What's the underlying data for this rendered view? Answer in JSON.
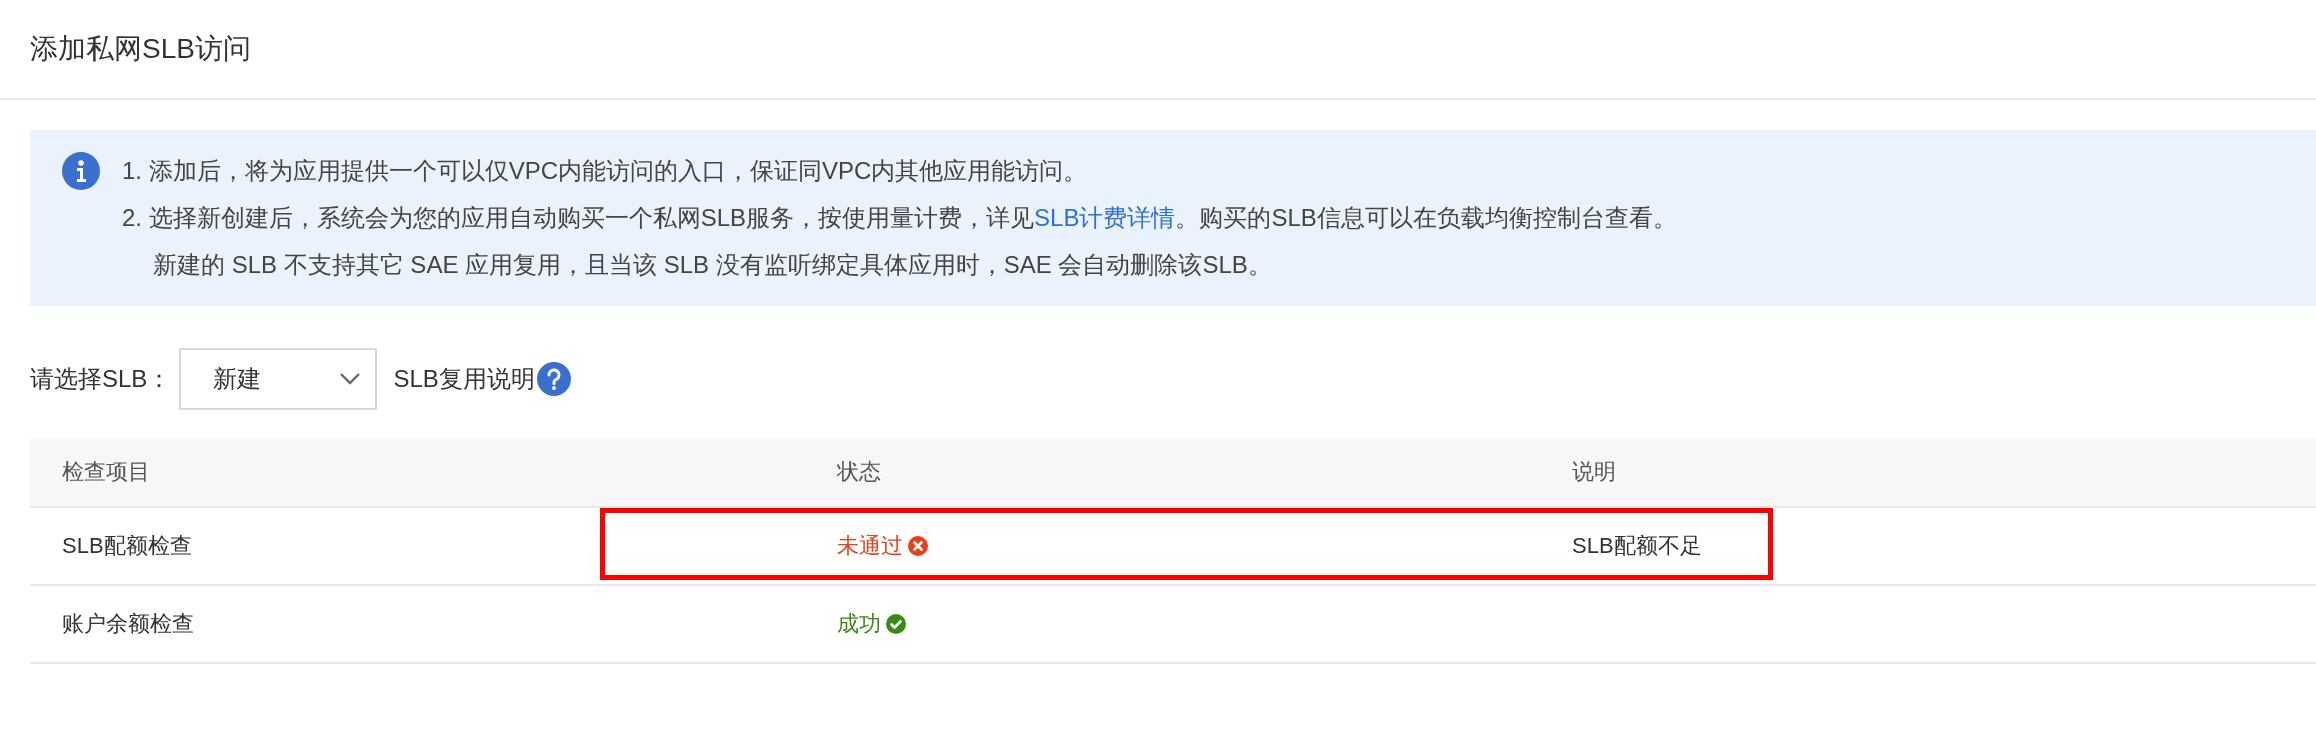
{
  "title": "添加私网SLB访问",
  "notice": {
    "lines": [
      {
        "text": "1. 添加后，将为应用提供一个可以仅VPC内能访问的入口，保证同VPC内其他应用能访问。"
      },
      {
        "text": "2. 选择新创建后，系统会为您的应用自动购买一个私网SLB服务，按使用量计费，详见",
        "link": "SLB计费详情",
        "after": "。购买的SLB信息可以在负载均衡控制台查看。"
      },
      {
        "text": "新建的 SLB 不支持其它 SAE 应用复用，且当该 SLB 没有监听绑定具体应用时，SAE 会自动删除该SLB。",
        "indent": true
      }
    ]
  },
  "slb_select": {
    "label": "请选择SLB：",
    "value": "新建",
    "help_link": "SLB复用说明"
  },
  "table": {
    "columns": [
      "检查项目",
      "状态",
      "说明"
    ],
    "rows": [
      {
        "item": "SLB配额检查",
        "status": {
          "kind": "failed",
          "text": "未通过"
        },
        "note": "SLB配额不足",
        "highlighted": true
      },
      {
        "item": "账户余额检查",
        "status": {
          "kind": "success",
          "text": "成功"
        },
        "highlighted": false
      }
    ]
  }
}
